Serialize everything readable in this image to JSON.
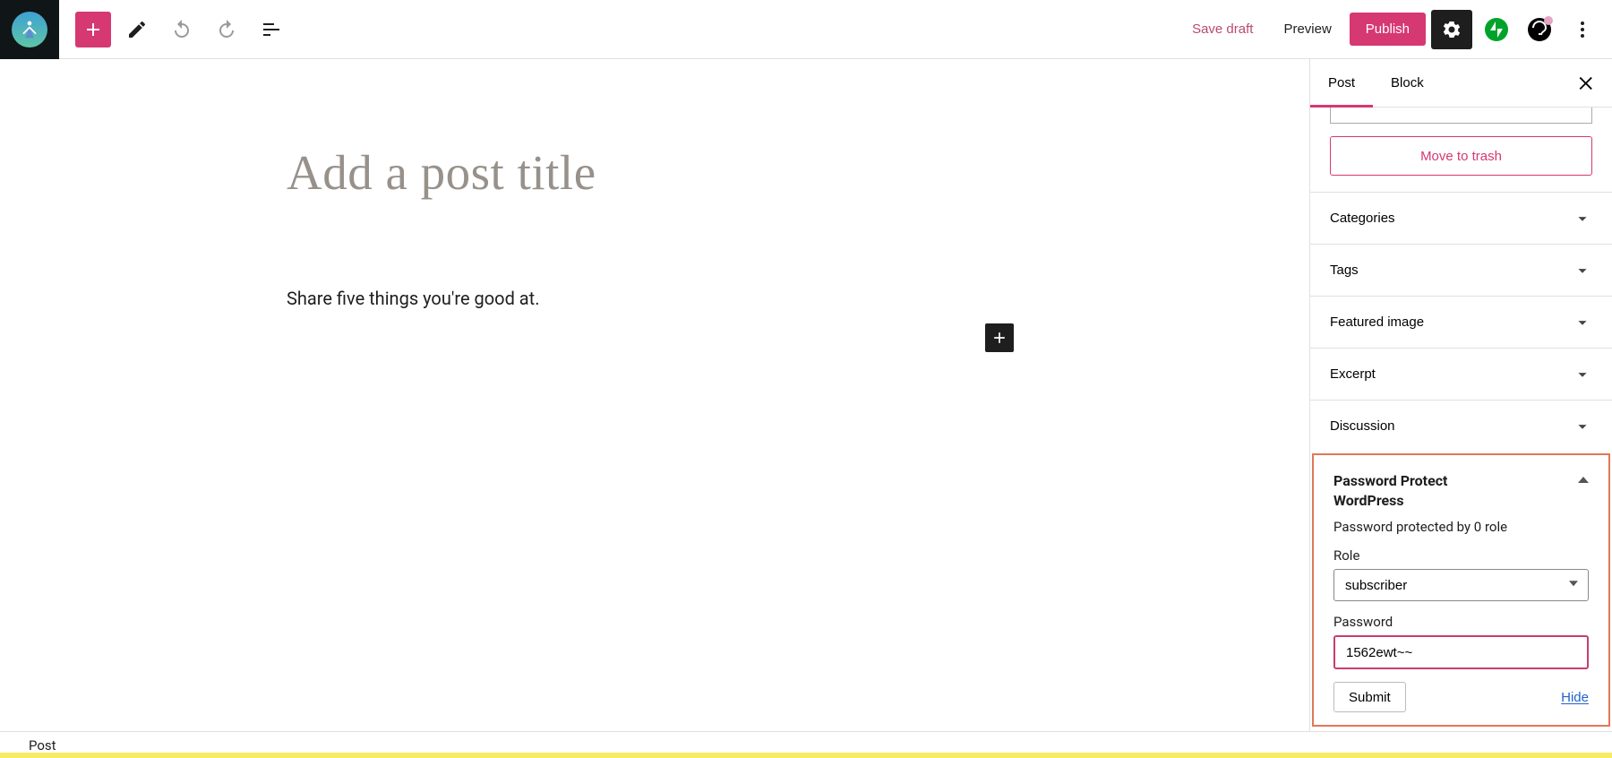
{
  "toolbar": {
    "save_draft": "Save draft",
    "preview": "Preview",
    "publish": "Publish"
  },
  "editor": {
    "title_placeholder": "Add a post title",
    "body_prompt": "Share five things you're good at."
  },
  "sidebar": {
    "tabs": {
      "post": "Post",
      "block": "Block"
    },
    "move_to_trash": "Move to trash",
    "sections": {
      "categories": "Categories",
      "tags": "Tags",
      "featured_image": "Featured image",
      "excerpt": "Excerpt",
      "discussion": "Discussion"
    },
    "password_protect": {
      "title_line1": "Password Protect",
      "title_line2": "WordPress",
      "status": "Password protected by 0 role",
      "role_label": "Role",
      "role_value": "subscriber",
      "password_label": "Password",
      "password_value": "1562ewt~~",
      "submit": "Submit",
      "hide": "Hide"
    }
  },
  "status": {
    "label": "Post"
  }
}
